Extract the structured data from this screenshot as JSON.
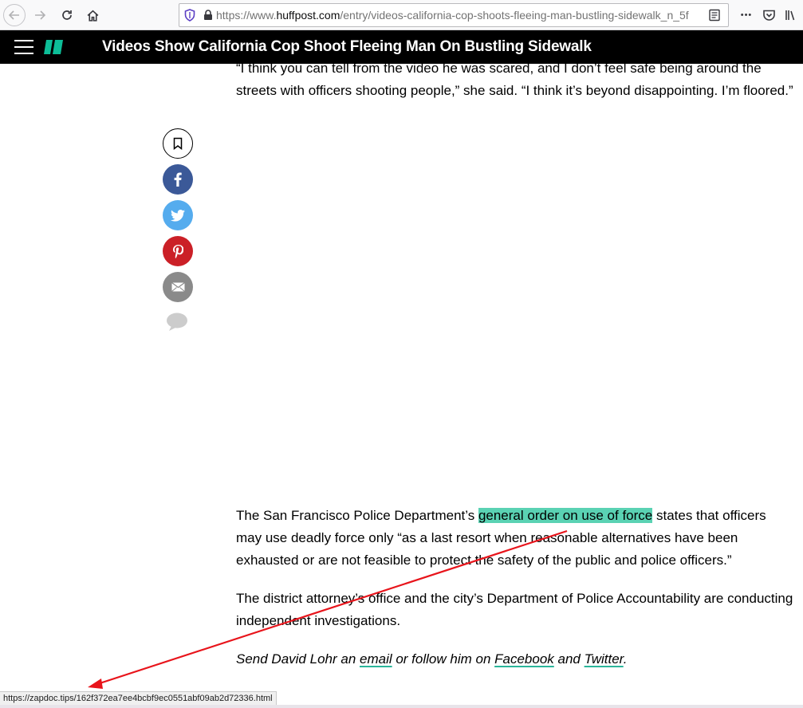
{
  "browser": {
    "url_prefix": "https://www.",
    "url_domain": "huffpost.com",
    "url_path": "/entry/videos-california-cop-shoots-fleeing-man-bustling-sidewalk_n_5f",
    "icons": {
      "back": "arrow-left-icon",
      "forward": "arrow-right-icon",
      "reload": "reload-icon",
      "home": "home-icon",
      "shield": "tracking-shield-icon",
      "lock": "lock-icon",
      "reader": "reader-view-icon",
      "more": "more-icon",
      "pocket": "pocket-icon",
      "library": "library-icon"
    },
    "more_glyph": "•••"
  },
  "header": {
    "headline": "Videos Show California Cop Shoot Fleeing Man On Bustling Sidewalk",
    "logo_color": "#0dbe98"
  },
  "share": {
    "colors": {
      "facebook": "#3b5998",
      "twitter": "#55acee",
      "pinterest": "#cb2027",
      "email": "#8a8a8a"
    }
  },
  "article": {
    "p1": "“I think you can tell from the video he was scared, and I don’t feel safe being around the streets with officers shooting people,” she said. “I think it’s beyond disappointing. I’m floored.”",
    "p2_before": "The San Francisco Police Department’s ",
    "p2_highlight": "general order on use of force",
    "p2_after": " states that officers may use deadly force only “as a last resort when reasonable alternatives have been exhausted or are not feasible to protect the safety of the public and police officers.”",
    "p3": "The district attorney’s office and the city’s Department of Police Accountability are conducting independent investigations.",
    "p4_a": "Send David Lohr an ",
    "p4_email": "email",
    "p4_b": " or follow him on ",
    "p4_facebook": "Facebook",
    "p4_c": " and ",
    "p4_twitter": "Twitter",
    "p4_d": "."
  },
  "status": {
    "link_url": "https://zapdoc.tips/162f372ea7ee4bcbf9ec0551abf09ab2d72336.html"
  },
  "annotation": {
    "arrow_color": "#e8141b"
  }
}
